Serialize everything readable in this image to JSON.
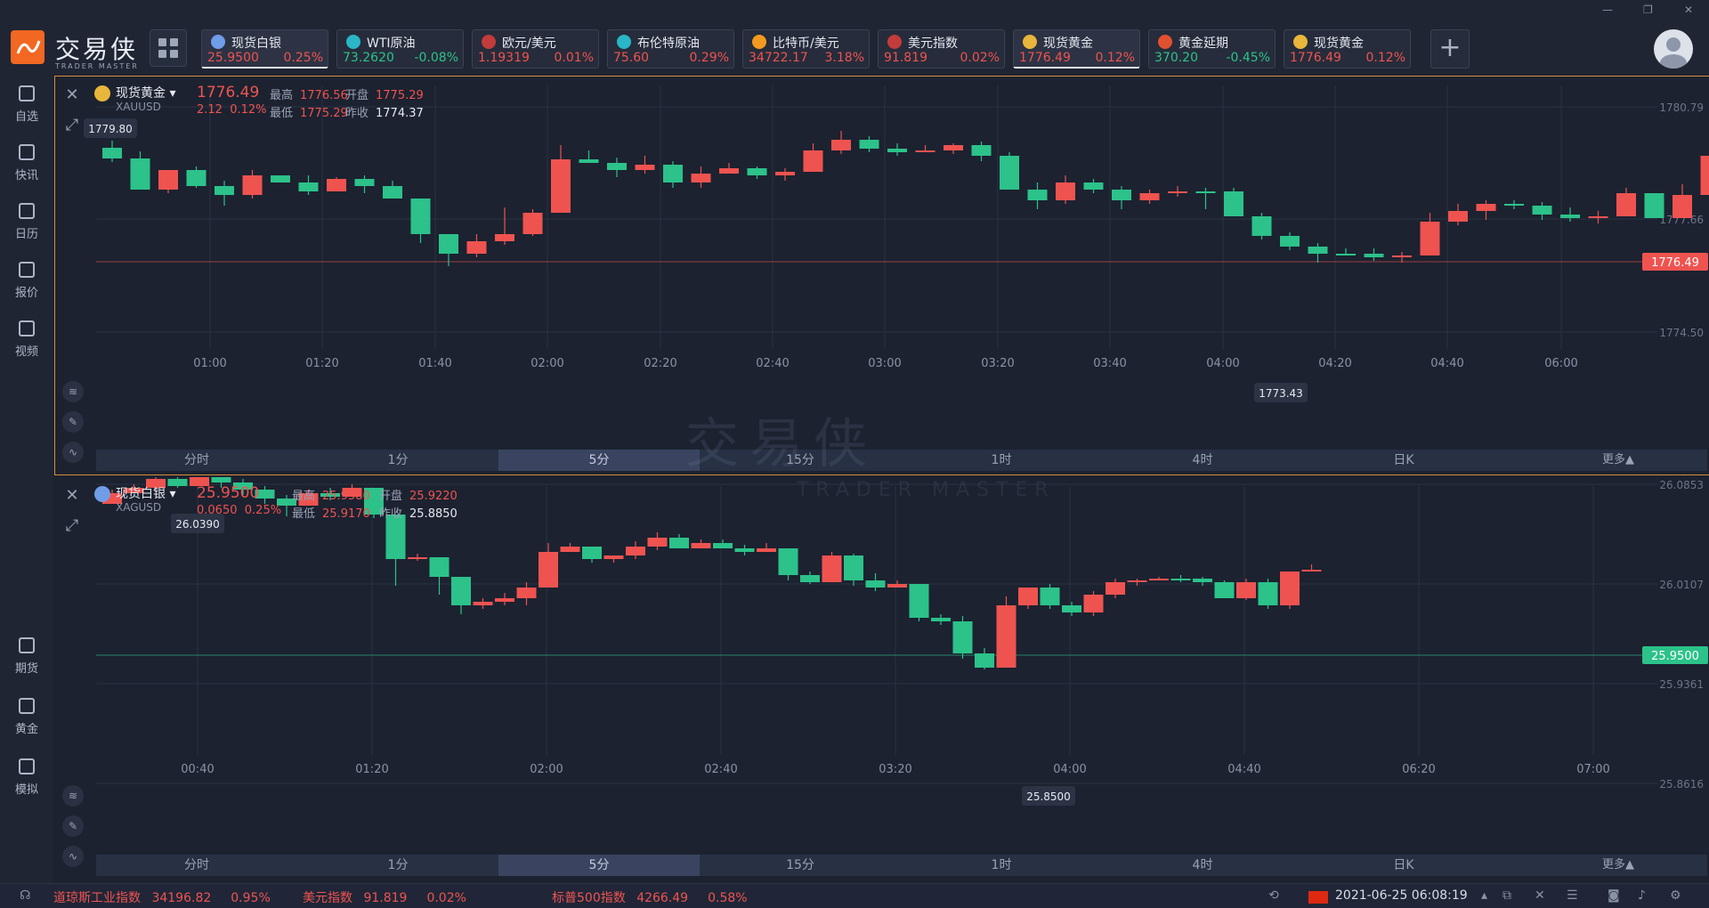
{
  "app": {
    "brand": "交易侠",
    "brand_sub": "TRADER MASTER"
  },
  "tickers": [
    {
      "name": "现货白银",
      "price": "25.9500",
      "pct": "0.25%",
      "dir": "up",
      "icon": "silver-coin-icon",
      "color": "#6f9de8",
      "active": true
    },
    {
      "name": "WTI原油",
      "price": "73.2620",
      "pct": "-0.08%",
      "dir": "down",
      "icon": "oil-barrel-icon",
      "color": "#29b6c6",
      "active": false
    },
    {
      "name": "欧元/美元",
      "price": "1.19319",
      "pct": "0.01%",
      "dir": "up",
      "icon": "us-flag-icon",
      "color": "#c33b3b",
      "active": false
    },
    {
      "name": "布伦特原油",
      "price": "75.60",
      "pct": "0.29%",
      "dir": "up",
      "icon": "oil-barrel-icon",
      "color": "#29b6c6",
      "active": false
    },
    {
      "name": "比特币/美元",
      "price": "34722.17",
      "pct": "3.18%",
      "dir": "up",
      "icon": "bitcoin-icon",
      "color": "#f29a1f",
      "active": false
    },
    {
      "name": "美元指数",
      "price": "91.819",
      "pct": "0.02%",
      "dir": "up",
      "icon": "us-flag-icon",
      "color": "#c33b3b",
      "active": false
    },
    {
      "name": "现货黄金",
      "price": "1776.49",
      "pct": "0.12%",
      "dir": "up",
      "icon": "gold-coin-icon",
      "color": "#e8b63a",
      "active": true
    },
    {
      "name": "黄金延期",
      "price": "370.20",
      "pct": "-0.45%",
      "dir": "down",
      "icon": "gold-bar-icon",
      "color": "#e0512f",
      "active": false
    },
    {
      "name": "现货黄金",
      "price": "1776.49",
      "pct": "0.12%",
      "dir": "up",
      "icon": "gold-coin-icon",
      "color": "#e8b63a",
      "active": false
    }
  ],
  "sidebar": [
    {
      "label": "自选",
      "icon": "bookmark-icon"
    },
    {
      "label": "快讯",
      "icon": "news-icon"
    },
    {
      "label": "日历",
      "icon": "calendar-icon"
    },
    {
      "label": "报价",
      "icon": "quote-chart-icon"
    },
    {
      "label": "视频",
      "icon": "video-icon"
    },
    {
      "label": "期货",
      "icon": "futures-icon"
    },
    {
      "label": "黄金",
      "icon": "gold-icon"
    },
    {
      "label": "模拟",
      "icon": "wallet-icon"
    }
  ],
  "timeframes": [
    "分时",
    "1分",
    "5分",
    "15分",
    "1时",
    "4时",
    "日K"
  ],
  "timeframe_more": "更多▲",
  "watermark": {
    "main": "交易侠",
    "sub": "TRADER MASTER"
  },
  "gold": {
    "name": "现货黄金",
    "code": "XAUUSD",
    "price": "1776.49",
    "change": "2.12",
    "change_pct": "0.12%",
    "high_label": "最高",
    "high": "1776.56",
    "open_label": "开盘",
    "open": "1775.29",
    "low_label": "最低",
    "low": "1775.29",
    "prev_label": "昨收",
    "prev": "1774.37",
    "price_tag": "1776.49",
    "max_tag": "1779.80",
    "min_tag": "1773.43",
    "yticks": [
      "1780.79",
      "1777.66",
      "1774.50"
    ],
    "xticks": [
      "01:00",
      "01:20",
      "01:40",
      "02:00",
      "02:20",
      "02:40",
      "03:00",
      "03:20",
      "03:40",
      "04:00",
      "04:20",
      "04:40",
      "06:00"
    ],
    "active_tf": 2
  },
  "silver": {
    "name": "现货白银",
    "code": "XAGUSD",
    "price": "25.9500",
    "change": "0.0650",
    "change_pct": "0.25%",
    "high_label": "最高",
    "high": "25.9580",
    "open_label": "开盘",
    "open": "25.9220",
    "low_label": "最低",
    "low": "25.9170",
    "prev_label": "昨收",
    "prev": "25.8850",
    "price_tag": "25.9500",
    "max_tag": "26.0390",
    "min_tag": "25.8500",
    "yticks": [
      "26.0853",
      "26.0107",
      "25.9361",
      "25.8616"
    ],
    "xticks": [
      "00:40",
      "01:20",
      "02:00",
      "02:40",
      "03:20",
      "04:00",
      "04:40",
      "06:20",
      "07:00"
    ],
    "active_tf": 2
  },
  "status": {
    "items": [
      {
        "name": "道琼斯工业指数",
        "value": "34196.82",
        "pct": "0.95%"
      },
      {
        "name": "美元指数",
        "value": "91.819",
        "pct": "0.02%"
      },
      {
        "name": "标普500指数",
        "value": "4266.49",
        "pct": "0.58%"
      }
    ],
    "time": "2021-06-25 06:08:19"
  },
  "colors": {
    "up": "#ef5350",
    "down": "#2cc28a",
    "accent": "#f26722"
  }
}
